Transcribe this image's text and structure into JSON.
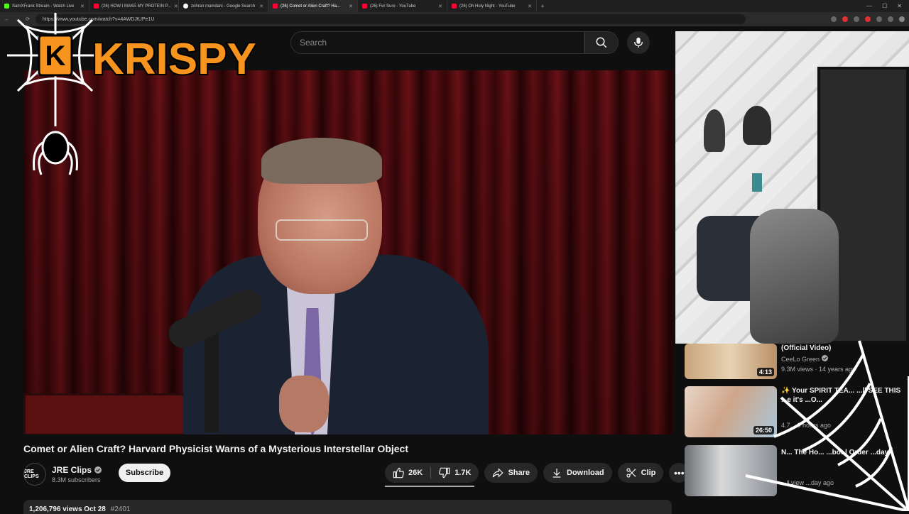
{
  "browser": {
    "tabs": [
      {
        "title": "SamXFrank Stream - Watch Live",
        "color": "#53fc18"
      },
      {
        "title": "(26) HOW I MAKE MY PROTEIN P...",
        "color": "#ff0033"
      },
      {
        "title": "zohran mamdani - Google Search",
        "color": "#ffffff"
      },
      {
        "title": "(26) Comet or Alien Craft? Ha...",
        "color": "#ff0033"
      },
      {
        "title": "(26) Fer Sure - YouTube",
        "color": "#ff0033"
      },
      {
        "title": "(26) Oh Holy Night - YouTube",
        "color": "#ff0033"
      }
    ],
    "url": "https://www.youtube.com/watch?v=4AWDJtUPe1U"
  },
  "youtube": {
    "search_placeholder": "Search",
    "video_title": "Comet or Alien Craft? Harvard Physicist Warns of a Mysterious Interstellar Object",
    "channel_name": "JRE Clips",
    "channel_avatar_text": "JRE CLIPS",
    "subscribers": "8.3M subscribers",
    "subscribe_label": "Subscribe",
    "likes": "26K",
    "dislikes": "1.7K",
    "share_label": "Share",
    "download_label": "Download",
    "clip_label": "Clip",
    "views_date": "1,206,796 views  Oct 28",
    "hashtag": "#2401"
  },
  "overlay": {
    "logo_text": "KRISPYW",
    "logo_color": "#f7941d"
  },
  "recommendations": [
    {
      "title": "(Official Video)",
      "channel": "CeeLo Green",
      "meta": "9.3M views · 14 years ago",
      "duration": "4:13"
    },
    {
      "title": "✨ Your SPIRIT TEA...  ...ll SEE THIS ...e it's ...O...",
      "channel": "",
      "meta": "4.7...   9 hours ago",
      "duration": "26:50"
    },
    {
      "title": "N... The Ho... ...bot | Order ...day",
      "channel": "",
      "meta": "...ll view ...day ago",
      "duration": ""
    }
  ]
}
